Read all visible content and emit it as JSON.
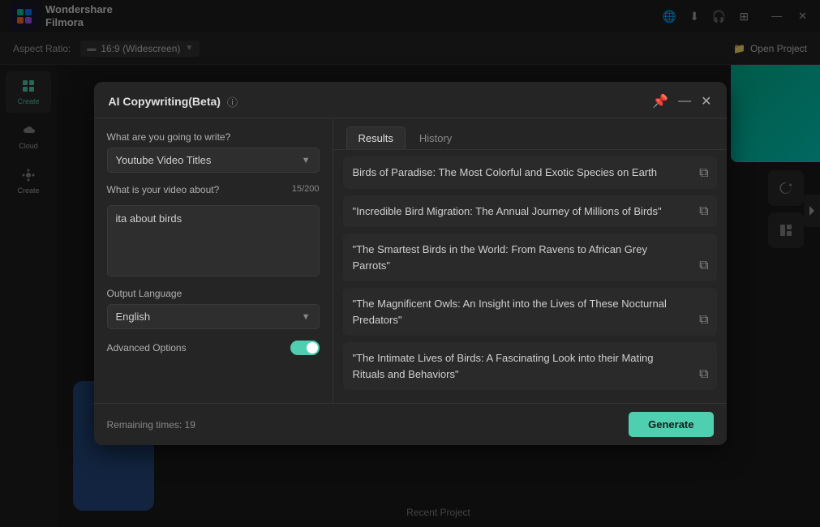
{
  "app": {
    "name_line1": "Wondershare",
    "name_line2": "Filmora",
    "logo_color": "#00c8a0"
  },
  "titlebar": {
    "aspect_label": "Aspect Ratio:",
    "aspect_value": "16:9 (Widescreen)",
    "open_project": "Open Project",
    "window_controls": {
      "minimize": "—",
      "close": "✕"
    }
  },
  "sidebar": {
    "items": [
      {
        "label": "Create",
        "active": true
      },
      {
        "label": "Cloud",
        "active": false
      },
      {
        "label": "Create",
        "active": false
      }
    ]
  },
  "modal": {
    "title": "AI Copywriting(Beta)",
    "tabs": [
      {
        "label": "Results",
        "active": true
      },
      {
        "label": "History",
        "active": false
      }
    ],
    "left": {
      "write_label": "What are you going to write?",
      "write_value": "Youtube Video Titles",
      "video_about_label": "What is your video about?",
      "char_count": "15/200",
      "textarea_value": "ita about birds",
      "output_language_label": "Output Language",
      "output_language_value": "English",
      "advanced_label": "Advanced Options",
      "remaining_label": "Remaining times: 19",
      "generate_btn": "Generate"
    },
    "results": [
      {
        "text": "Birds of Paradise: The Most Colorful and Exotic Species on Earth"
      },
      {
        "text": "\"Incredible Bird Migration: The Annual Journey of Millions of Birds\""
      },
      {
        "text": "\"The Smartest Birds in the World: From Ravens to African Grey Parrots\""
      },
      {
        "text": "\"The Magnificent Owls: An Insight into the Lives of These Nocturnal Predators\""
      },
      {
        "text": "\"The Intimate Lives of Birds: A Fascinating Look into their Mating Rituals and Behaviors\""
      }
    ]
  },
  "bottom_bar": {
    "recent_project": "Recent Project"
  }
}
